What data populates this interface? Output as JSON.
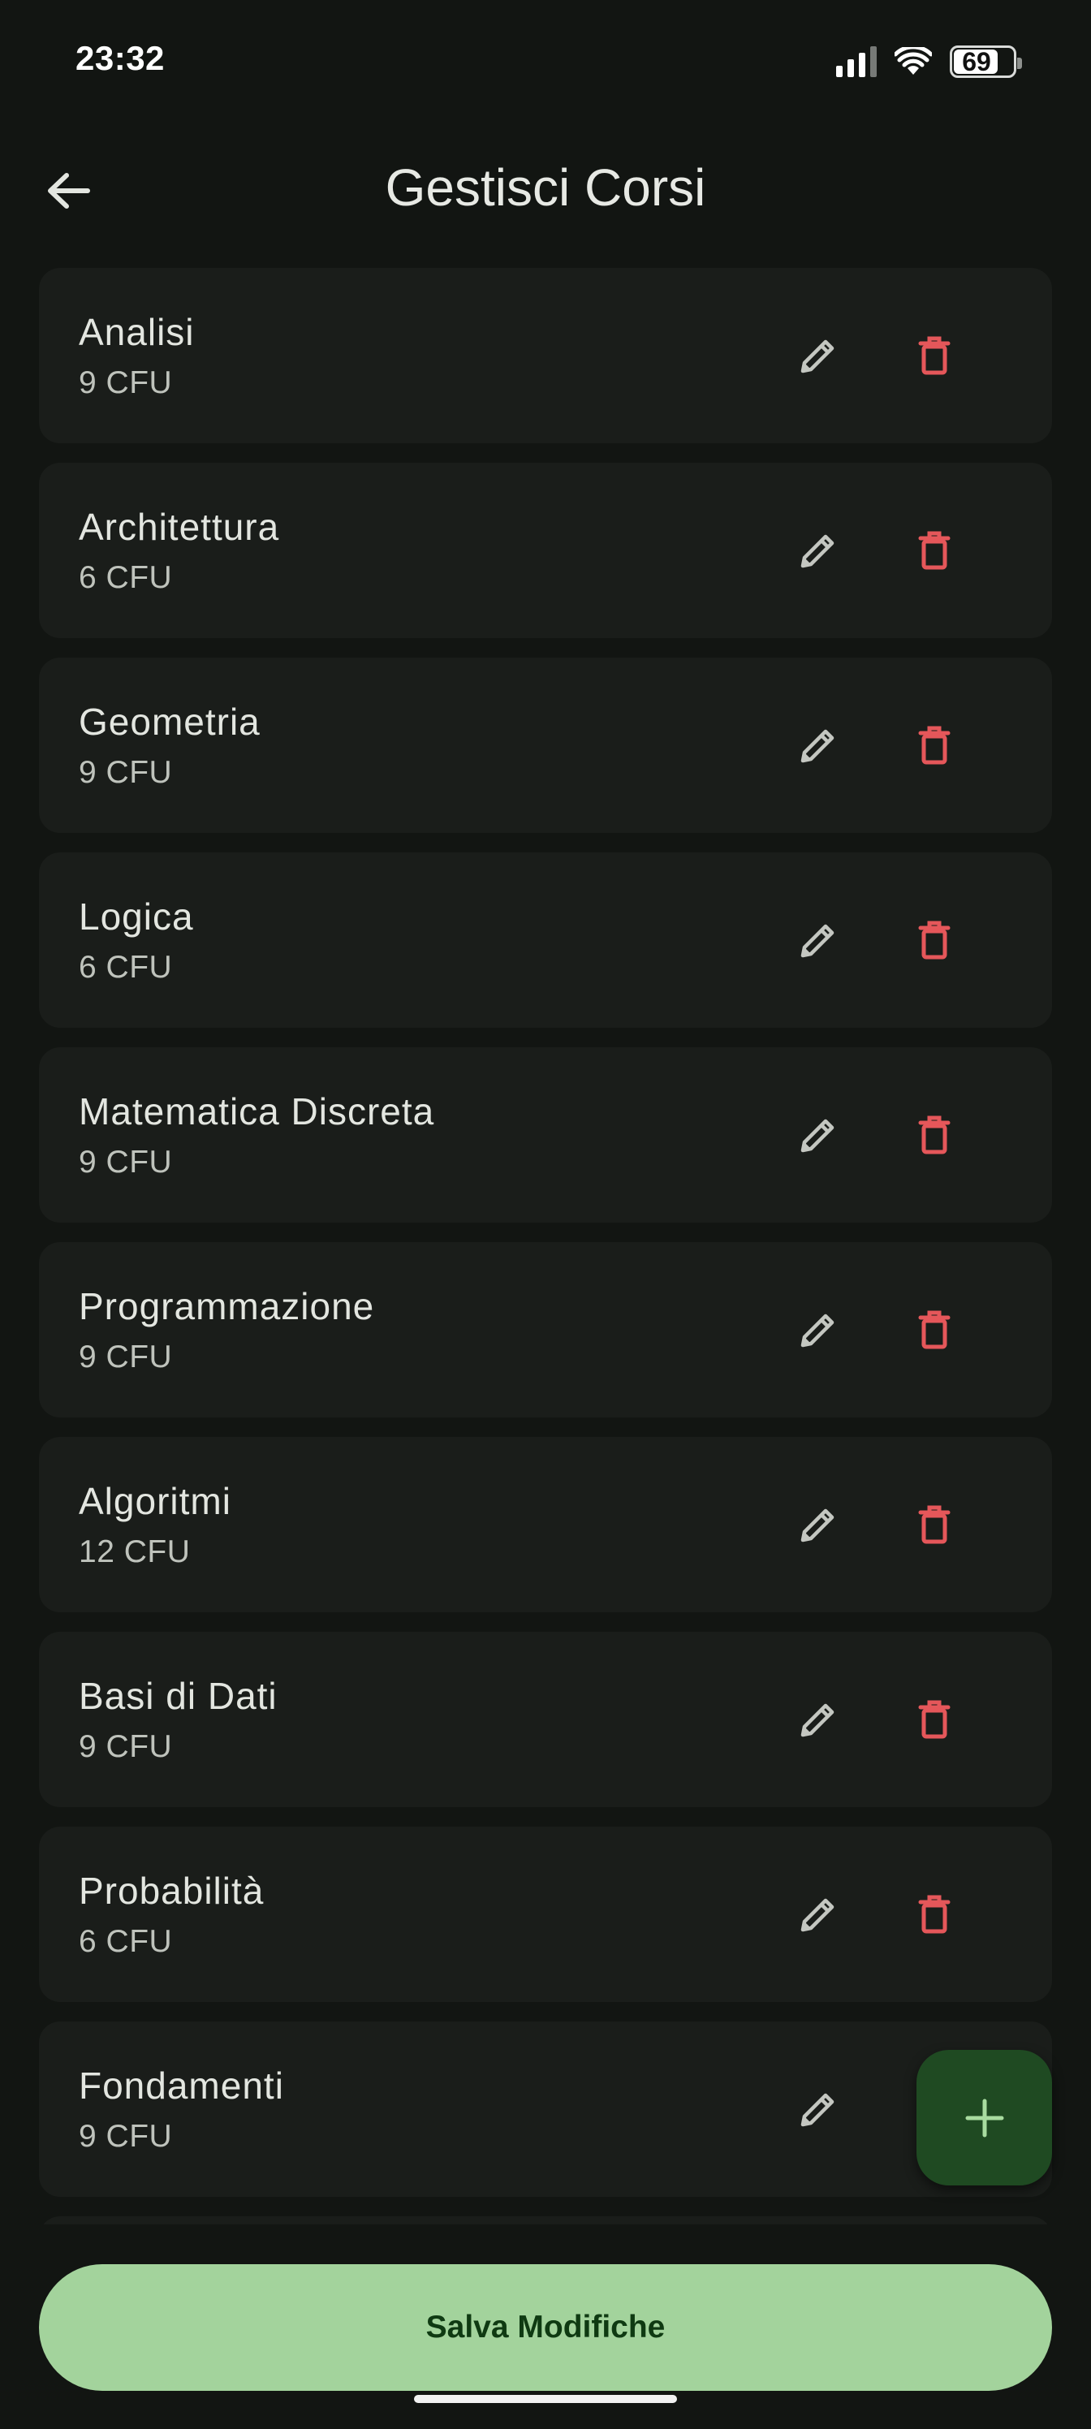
{
  "status_bar": {
    "time": "23:32",
    "battery": "69"
  },
  "app_bar": {
    "title": "Gestisci Corsi",
    "back_icon": "arrow-back-icon"
  },
  "courses": [
    {
      "name": "Analisi",
      "cfu": "9 CFU"
    },
    {
      "name": "Architettura",
      "cfu": "6 CFU"
    },
    {
      "name": "Geometria",
      "cfu": "9 CFU"
    },
    {
      "name": "Logica",
      "cfu": "6 CFU"
    },
    {
      "name": "Matematica Discreta",
      "cfu": "9 CFU"
    },
    {
      "name": "Programmazione",
      "cfu": "9 CFU"
    },
    {
      "name": "Algoritmi",
      "cfu": "12 CFU"
    },
    {
      "name": "Basi di Dati",
      "cfu": "9 CFU"
    },
    {
      "name": "Probabilità",
      "cfu": "6 CFU"
    },
    {
      "name": "Fondamenti",
      "cfu": "9 CFU"
    }
  ],
  "icons": {
    "edit": "pencil-icon",
    "delete": "trash-icon",
    "add": "plus-icon"
  },
  "colors": {
    "background": "#121512",
    "card": "#1a1d1a",
    "delete_red": "#e5575a",
    "edit_grey": "#c4c7c1",
    "fab": "#1f4a22",
    "fab_icon": "#a8dca0",
    "save_button": "#a3d39c",
    "save_text": "#0f3a12"
  },
  "footer": {
    "save_label": "Salva Modifiche"
  }
}
